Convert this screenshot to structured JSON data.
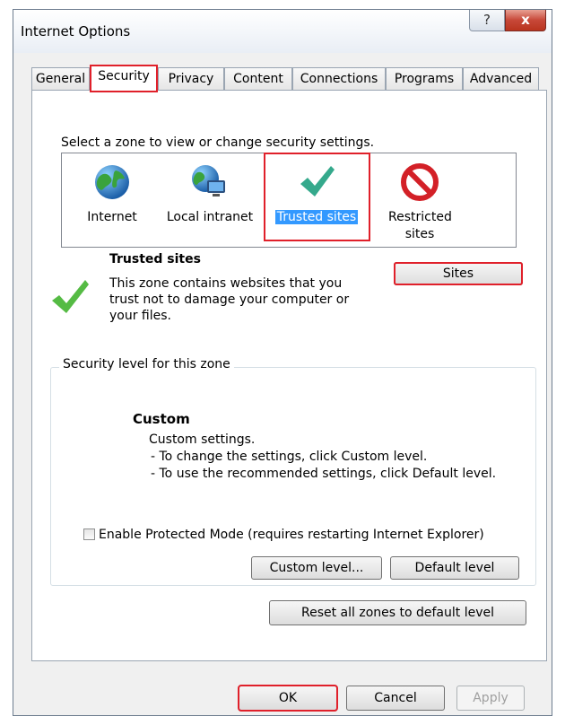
{
  "window": {
    "title": "Internet Options",
    "help_glyph": "?",
    "close_glyph": "x"
  },
  "tabs": [
    "General",
    "Security",
    "Privacy",
    "Content",
    "Connections",
    "Programs",
    "Advanced"
  ],
  "active_tab": "Security",
  "zone_prompt": "Select a zone to view or change security settings.",
  "zones": [
    {
      "label": "Internet",
      "icon": "globe-icon"
    },
    {
      "label": "Local intranet",
      "icon": "intranet-globe-icon"
    },
    {
      "label": "Trusted sites",
      "icon": "checkmark-icon",
      "selected": true
    },
    {
      "label": "Restricted sites",
      "icon": "no-entry-icon"
    }
  ],
  "zone_info": {
    "title": "Trusted sites",
    "description": "This zone contains websites that you trust not to damage your computer or your files.",
    "sites_button": "Sites"
  },
  "security_level": {
    "group_label": "Security level for this zone",
    "level_name": "Custom",
    "lines": [
      "Custom settings.",
      "- To change the settings, click Custom level.",
      "- To use the recommended settings, click Default level."
    ],
    "protected_mode_label": "Enable Protected Mode (requires restarting Internet Explorer)",
    "protected_mode_checked": false,
    "custom_level_button": "Custom level...",
    "default_level_button": "Default level"
  },
  "reset_button": "Reset all zones to default level",
  "footer": {
    "ok": "OK",
    "cancel": "Cancel",
    "apply": "Apply"
  },
  "colors": {
    "highlight": "#e0202a",
    "selection": "#3399ff",
    "check_green": "#4caf50"
  }
}
